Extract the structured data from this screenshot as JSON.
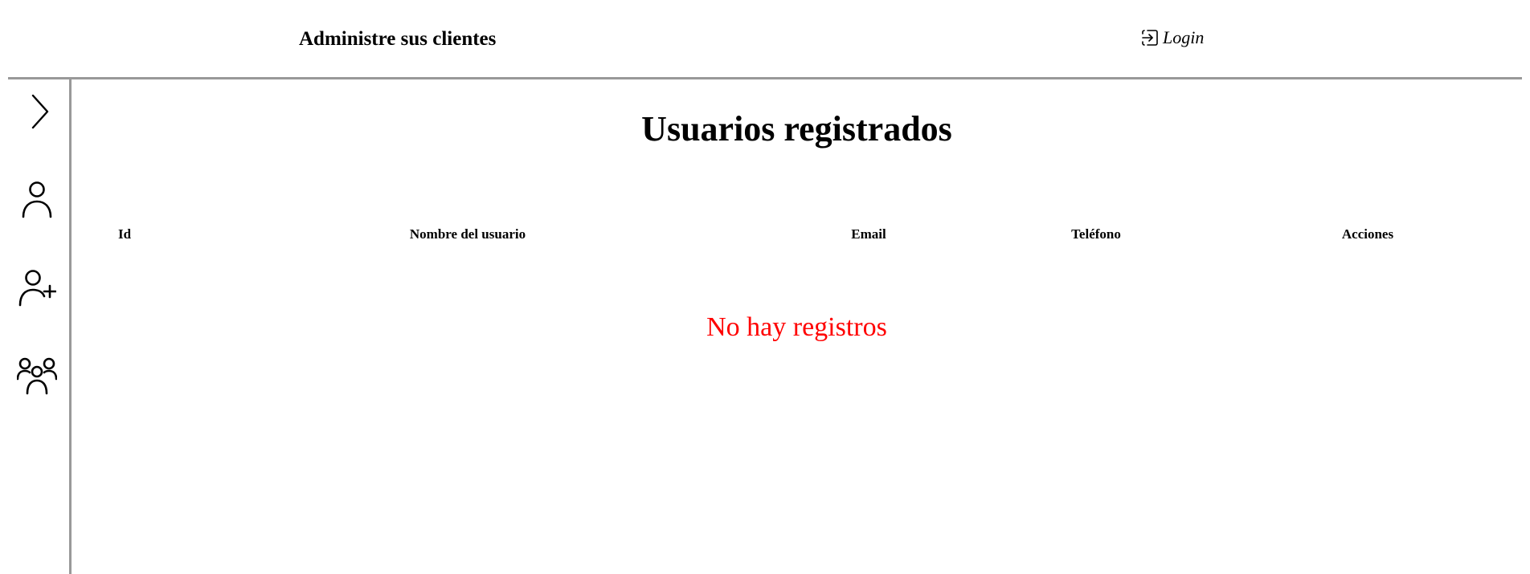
{
  "header": {
    "title": "Administre sus clientes",
    "login_label": "Login",
    "login_icon": "login-icon"
  },
  "sidebar": {
    "items": [
      {
        "name": "expand",
        "icon": "chevron-right-icon"
      },
      {
        "name": "user",
        "icon": "user-icon"
      },
      {
        "name": "add-user",
        "icon": "user-add-icon"
      },
      {
        "name": "users",
        "icon": "users-group-icon"
      }
    ]
  },
  "main": {
    "title": "Usuarios registrados",
    "table": {
      "columns": [
        "Id",
        "Nombre del usuario",
        "Email",
        "Teléfono",
        "Acciones"
      ],
      "rows": []
    },
    "empty_message": "No hay registros"
  },
  "colors": {
    "divider": "#999999",
    "empty_message": "#ff0000",
    "text": "#000000"
  }
}
